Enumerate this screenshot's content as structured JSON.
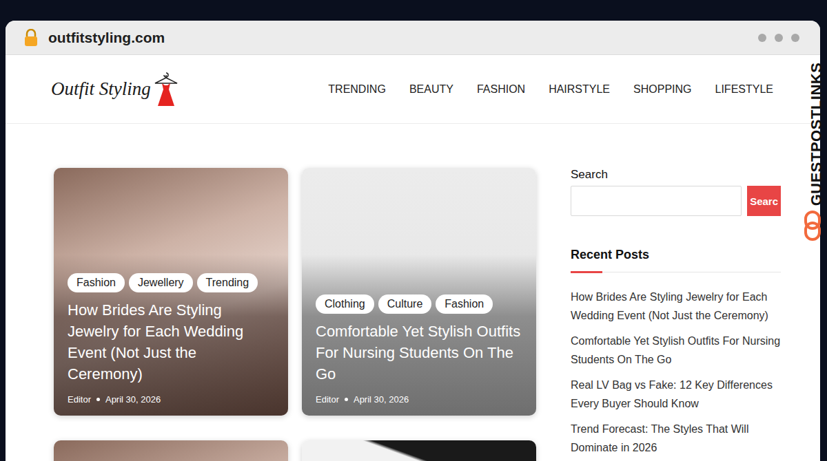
{
  "browser": {
    "url": "outfitstyling.com",
    "secure": true
  },
  "watermark": {
    "text": "GUESTPOSTLINKS"
  },
  "site": {
    "logo": "Outfit Styling",
    "nav": [
      {
        "label": "TRENDING"
      },
      {
        "label": "BEAUTY"
      },
      {
        "label": "FASHION"
      },
      {
        "label": "HAIRSTYLE"
      },
      {
        "label": "SHOPPING"
      },
      {
        "label": "LIFESTYLE"
      }
    ]
  },
  "cards": [
    {
      "tags": [
        "Fashion",
        "Jewellery",
        "Trending"
      ],
      "title": "How Brides Are Styling Jewelry for Each Wedding Event (Not Just the Ceremony)",
      "author": "Editor",
      "date": "April 30, 2026",
      "kind": "photo"
    },
    {
      "tags": [
        "Clothing",
        "Culture",
        "Fashion"
      ],
      "title": "Comfortable Yet Stylish Outfits For Nursing Students On The Go",
      "author": "Editor",
      "date": "April 30, 2026",
      "kind": "illustration"
    }
  ],
  "lower_cards": [
    {
      "kind": "photo"
    },
    {
      "kind": "graphic"
    }
  ],
  "sidebar": {
    "search_label": "Search",
    "search_button": "Searc",
    "recent_title": "Recent Posts",
    "recent": [
      "How Brides Are Styling Jewelry for Each Wedding Event (Not Just the Ceremony)",
      "Comfortable Yet Stylish Outfits For Nursing Students On The Go",
      "Real LV Bag vs Fake: 12 Key Differences Every Buyer Should Know",
      "Trend Forecast: The Styles That Will Dominate in 2026"
    ]
  }
}
